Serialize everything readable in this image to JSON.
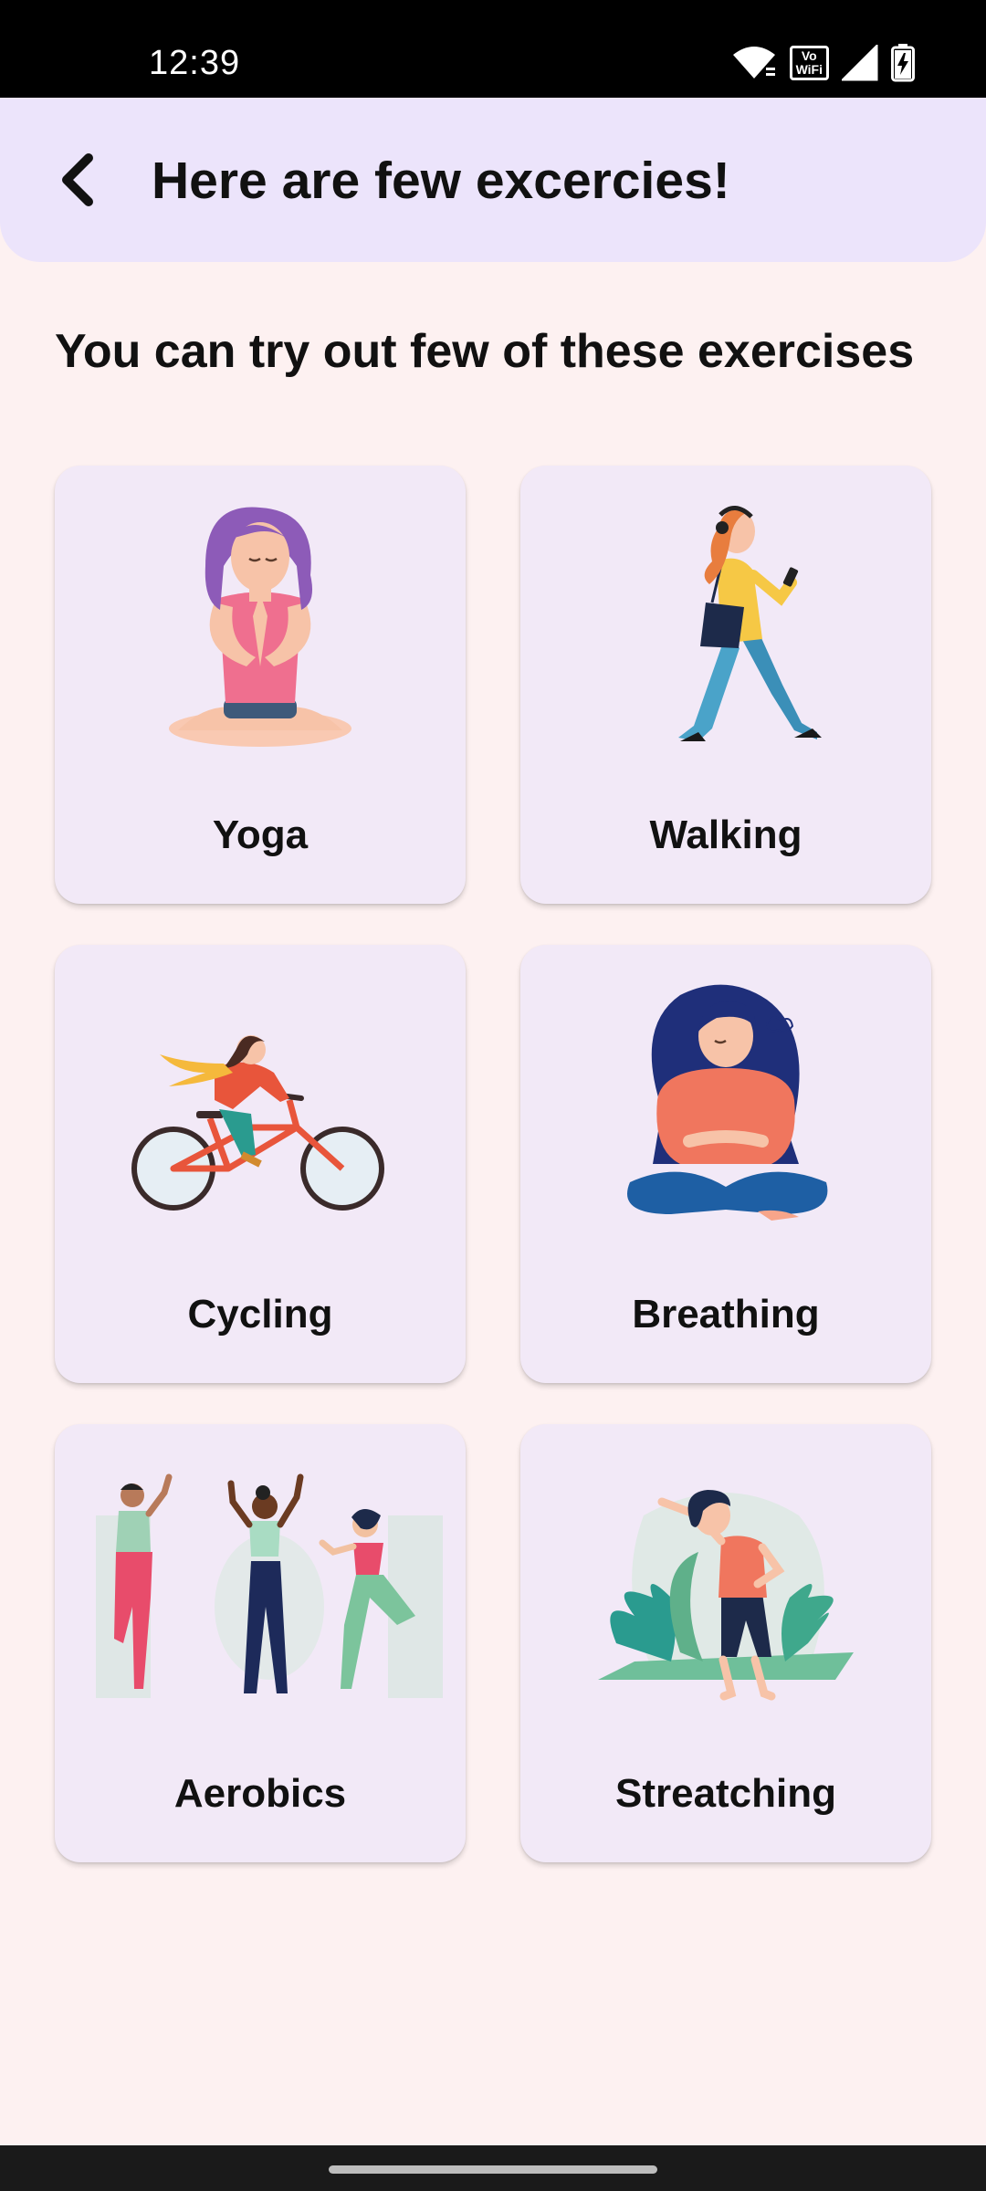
{
  "status_bar": {
    "time": "12:39",
    "icons": [
      "wifi-icon",
      "vowifi-icon",
      "cell-signal-icon",
      "battery-charging-icon"
    ],
    "vowifi_label_top": "Vo",
    "vowifi_label_bottom": "WiFi"
  },
  "app_bar": {
    "back_icon": "chevron-left-icon",
    "title": "Here are few excercies!"
  },
  "main": {
    "subtitle": "You can try out few of these exercises",
    "exercises": [
      {
        "label": "Yoga",
        "illustration": "yoga-illustration"
      },
      {
        "label": "Walking",
        "illustration": "walking-illustration"
      },
      {
        "label": "Cycling",
        "illustration": "cycling-illustration"
      },
      {
        "label": "Breathing",
        "illustration": "breathing-illustration"
      },
      {
        "label": "Aerobics",
        "illustration": "aerobics-illustration"
      },
      {
        "label": "Streatching",
        "illustration": "stretching-illustration"
      }
    ]
  },
  "colors": {
    "background": "#fdf1f1",
    "app_bar": "#ece4fb",
    "card": "#f2e9f7",
    "status_bar": "#000000"
  }
}
